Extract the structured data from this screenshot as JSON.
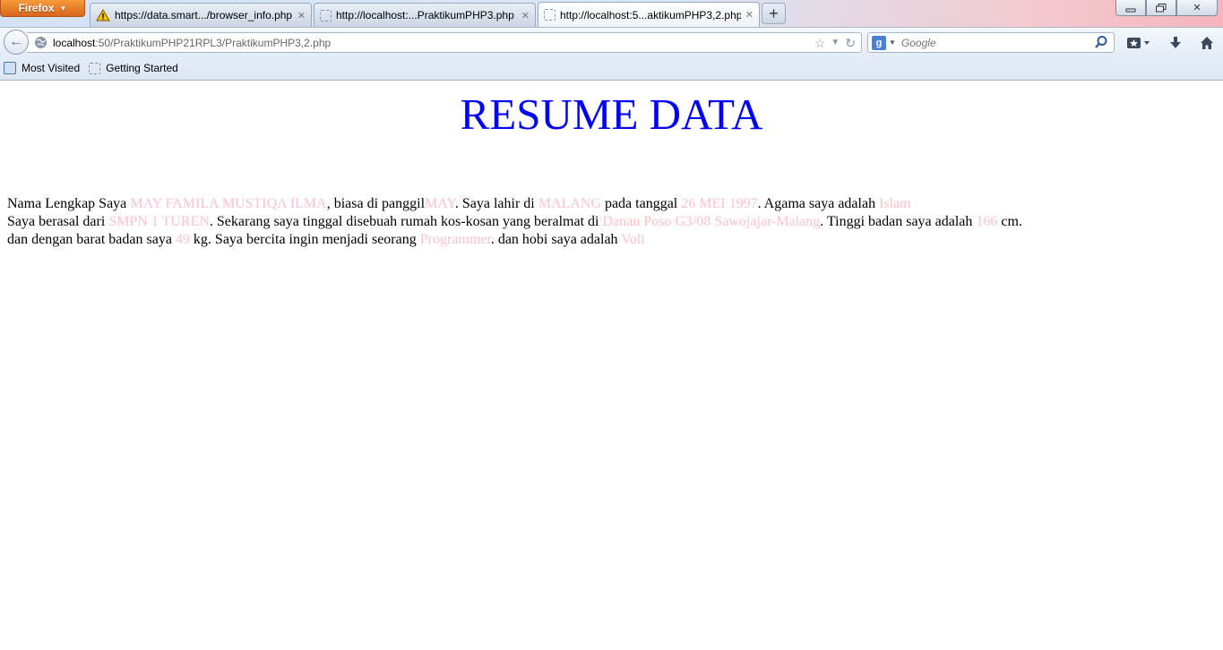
{
  "browser": {
    "menu_button": "Firefox",
    "tabs": [
      {
        "title": "https://data.smart.../browser_info.php",
        "active": false,
        "icon": "warning-icon"
      },
      {
        "title": "http://localhost:...PraktikumPHP3.php",
        "active": false,
        "icon": "page-icon"
      },
      {
        "title": "http://localhost:5...aktikumPHP3,2.php",
        "active": true,
        "icon": "page-icon"
      }
    ],
    "new_tab": "+",
    "url": {
      "host": "localhost",
      "path": ":50/PraktikumPHP21RPL3/PraktikumPHP3,2.php"
    },
    "search": {
      "placeholder": "Google"
    },
    "bookmarks": [
      "Most Visited",
      "Getting Started"
    ]
  },
  "page": {
    "title": "RESUME DATA",
    "line1": {
      "t1": "Nama Lengkap Saya ",
      "nama": "MAY FAMILA MUSTIQA ILMA",
      "t2": ", biasa di panggil",
      "panggilan": "MAY",
      "t3": ". Saya lahir di ",
      "kota_lahir": "MALANG",
      "t4": " pada tanggal ",
      "tanggal": "26 MEI 1997",
      "t5": ". Agama saya adalah ",
      "agama": "Islam"
    },
    "line2": {
      "t1": "Saya berasal dari ",
      "sekolah": "SMPN 1 TUREN",
      "t2": ". Sekarang saya tinggal disebuah rumah kos-kosan yang beralmat di ",
      "alamat": "Danau Poso G3/08 Sawojajar-Malang",
      "t3": ". Tinggi badan saya adalah ",
      "tinggi": "166",
      "t4": " cm."
    },
    "line3": {
      "t1": "dan dengan barat badan saya ",
      "berat": "49",
      "t2": " kg. Saya bercita ingin menjadi seorang ",
      "cita": "Programmer",
      "t3": ". dan hobi saya adalah ",
      "hobi": "Voli"
    }
  },
  "colors": {
    "title": "#0000ff",
    "values": "#ffc0cb",
    "firefox_button": "#e57b26"
  }
}
